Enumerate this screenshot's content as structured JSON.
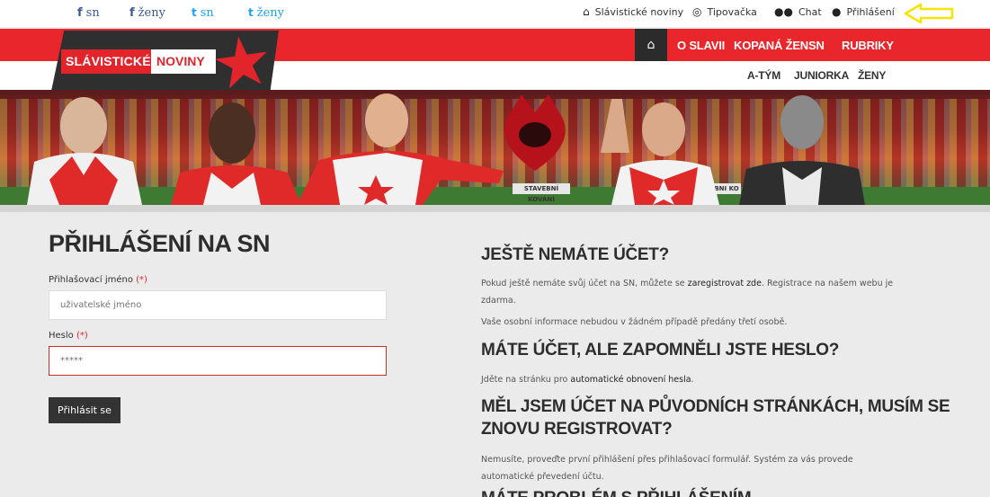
{
  "social": [
    {
      "glyph": "f",
      "label": "sn",
      "kind": "facebook"
    },
    {
      "glyph": "f",
      "label": "ženy",
      "kind": "facebook"
    },
    {
      "glyph": "t",
      "label": "sn",
      "kind": "twitter"
    },
    {
      "glyph": "t",
      "label": "ženy",
      "kind": "twitter"
    }
  ],
  "utility": [
    {
      "icon": "home-icon",
      "glyph": "⌂",
      "label": "Slávistické noviny"
    },
    {
      "icon": "mask-icon",
      "glyph": "◎",
      "label": "Tipovačka"
    },
    {
      "icon": "users-icon",
      "glyph": "👥",
      "label": "Chat"
    },
    {
      "icon": "user-icon",
      "glyph": "👤",
      "label": "Přihlášení"
    }
  ],
  "logo": {
    "part1": "SLÁVISTICKÉ",
    "part2": "NOVINY"
  },
  "nav": {
    "home_glyph": "⌂",
    "primary": [
      "O SLAVII",
      "KOPANÁ ŽEN",
      "SN",
      "RUBRIKY"
    ],
    "secondary": [
      "A-TÝM",
      "JUNIORKA",
      "ŽENY"
    ]
  },
  "banner": {
    "boards": [
      "STAVEBNÍ KOVÁNÍ",
      "BNI KO"
    ]
  },
  "login": {
    "title": "PŘIHLÁŠENÍ NA SN",
    "username_label": "Přihlašovací jméno",
    "username_placeholder": "uživatelské jméno",
    "password_label": "Heslo",
    "password_placeholder": "*****",
    "required_mark": "(*)",
    "submit": "Přihlásit se"
  },
  "info": {
    "no_account_title": "JEŠTĚ NEMÁTE ÚČET?",
    "no_account_p1_a": "Pokud ještě nemáte svůj účet na SN, můžete se ",
    "no_account_p1_link": "zaregistrovat zde",
    "no_account_p1_b": ". Registrace na našem webu je zdarma.",
    "no_account_p2": "Vaše osobní informace nebudou v žádném případě předány třetí osobě.",
    "forgot_title": "MÁTE ÚČET, ALE ZAPOMNĚLI JSTE HESLO?",
    "forgot_p_a": "Jděte na stránku pro ",
    "forgot_p_link": "automatické obnovení hesla",
    "forgot_p_b": ".",
    "old_title_1": "MĚL JSEM ÚČET NA PŮVODNÍCH STRÁNKÁCH, MUSÍM SE",
    "old_title_2": "ZNOVU REGISTROVAT?",
    "old_p": "Nemusíte, proveďte první přihlášení přes přihlašovací formulář. Systém za vás provede automatické převedení účtu.",
    "problem_title": "MÁTE PROBLÉM S PŘIHLÁŠENÍM"
  },
  "colors": {
    "brand_red": "#e8262b",
    "dark": "#2d2d2d",
    "annotation": "#f5e400"
  }
}
